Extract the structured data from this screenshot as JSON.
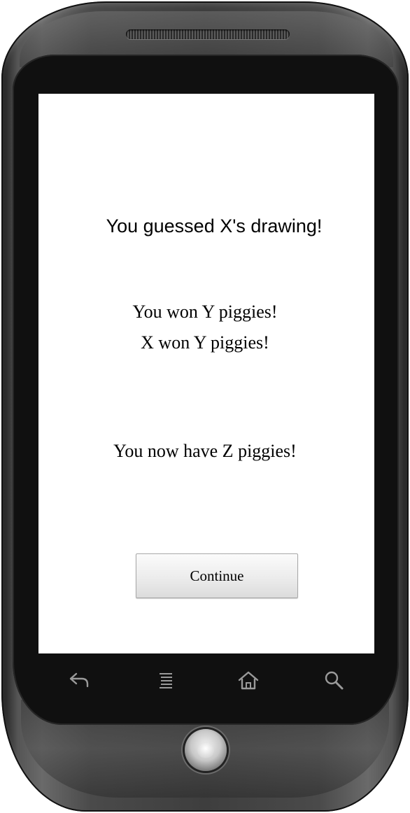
{
  "screen": {
    "title": "You guessed X's drawing!",
    "you_won": "You won Y piggies!",
    "x_won": "X won Y piggies!",
    "total": "You now have Z piggies!",
    "continue_label": "Continue"
  },
  "navbar": {
    "icons": [
      "back-icon",
      "menu-icon",
      "home-icon",
      "search-icon"
    ]
  },
  "colors": {
    "screen_background": "#ffffff",
    "text": "#000000",
    "bezel": "#101010",
    "button_border": "#a8a8a8"
  }
}
